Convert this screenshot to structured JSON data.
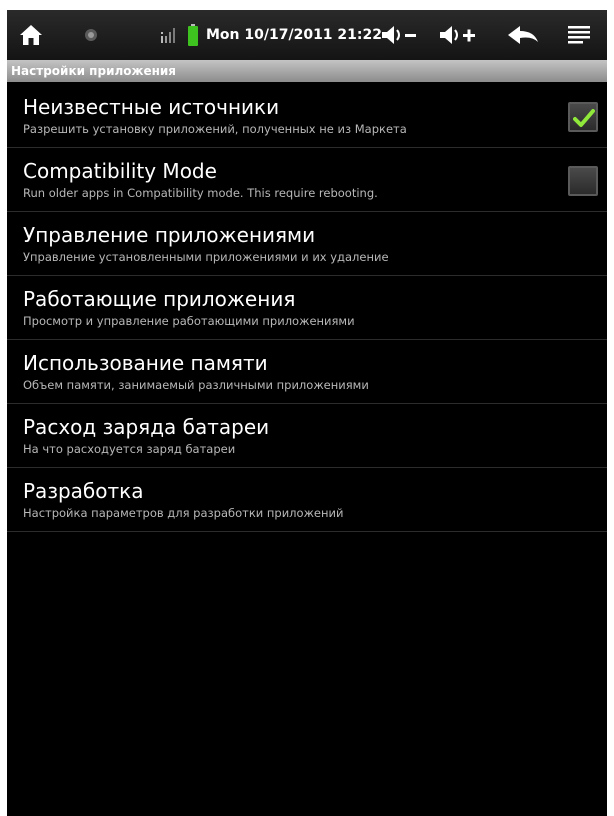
{
  "status_bar": {
    "icons": {
      "home": "home-icon",
      "dot": "notification-dot-icon",
      "signal": "signal-icon",
      "battery": "battery-icon",
      "volume_down": "volume-down-icon",
      "volume_up": "volume-up-icon",
      "back": "back-icon",
      "menu": "menu-icon"
    },
    "clock": "Mon 10/17/2011 21:22",
    "battery_color": "#3ec21f"
  },
  "section_header": "Настройки приложения",
  "settings": [
    {
      "title": "Неизвестные источники",
      "subtitle": "Разрешить установку приложений, полученных не из Маркета",
      "checked": true
    },
    {
      "title": "Compatibility Mode",
      "subtitle": "Run older apps in Compatibility mode. This require rebooting.",
      "checked": false
    },
    {
      "title": "Управление приложениями",
      "subtitle": "Управление установленными приложениями и их удаление"
    },
    {
      "title": "Работающие приложения",
      "subtitle": "Просмотр и управление работающими приложениями"
    },
    {
      "title": "Использование памяти",
      "subtitle": "Объем памяти, занимаемый различными приложениями"
    },
    {
      "title": "Расход заряда батареи",
      "subtitle": "На что расходуется заряд батареи"
    },
    {
      "title": "Разработка",
      "subtitle": "Настройка параметров для разработки приложений"
    }
  ],
  "colors": {
    "check_mark": "#8fe83a",
    "background": "#000000"
  }
}
